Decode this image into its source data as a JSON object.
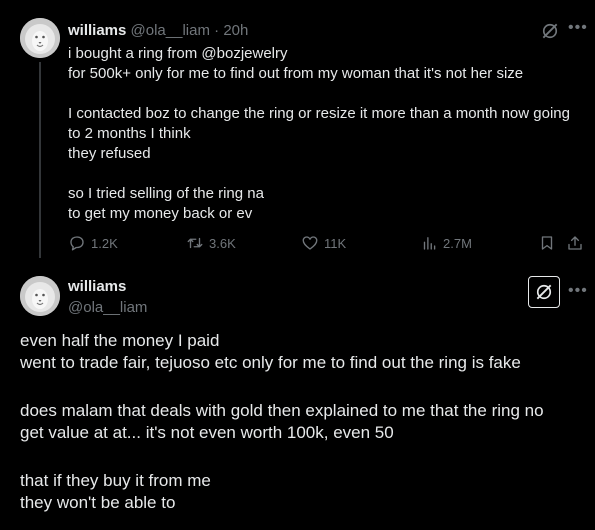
{
  "tweet1": {
    "name": "williams",
    "handle": "@ola__liam",
    "separator": "·",
    "time": "20h",
    "lines": [
      "i bought a ring from @bozjewelry",
      "for 500k+ only for me to find out from my woman that it's not her size",
      "",
      "I contacted boz to change the ring or resize it more than a month now going",
      "to 2 months I think",
      "they refused",
      "",
      "so I tried selling of the ring na",
      "to get my money back or ev"
    ],
    "stats": {
      "replies": "1.2K",
      "reposts": "3.6K",
      "likes": "11K",
      "views": "2.7M"
    }
  },
  "tweet2": {
    "name": "williams",
    "handle": "@ola__liam",
    "lines": [
      "even half the money I paid",
      "went to trade fair, tejuoso etc only for me to find out the ring is fake",
      "",
      "does malam that deals with gold then explained to me that the ring no",
      "get value at at... it's not even worth 100k, even 50",
      "",
      "that if they buy it from me",
      "they won't be able to"
    ]
  },
  "icons": {
    "more": "more-horizontal-icon",
    "grok": "grok-icon",
    "reply": "reply-icon",
    "repost": "repost-icon",
    "like": "heart-icon",
    "views": "views-icon",
    "bookmark": "bookmark-icon",
    "share": "share-icon"
  },
  "colors": {
    "background": "#000000",
    "text": "#e7e9ea",
    "muted": "#71767b",
    "divider": "#333639"
  }
}
